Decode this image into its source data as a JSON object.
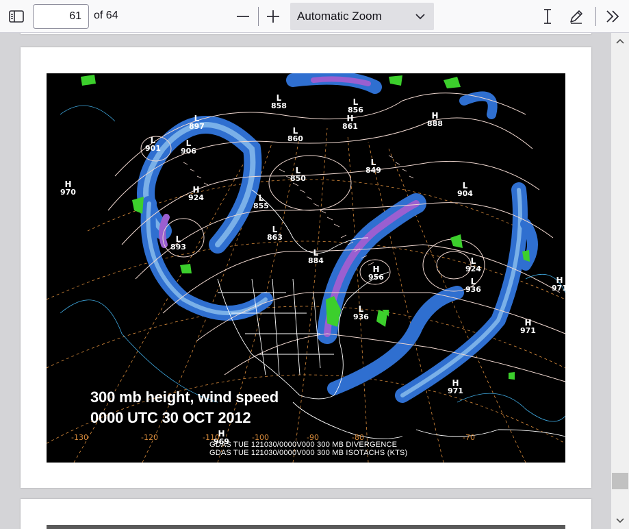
{
  "toolbar": {
    "current_page": "61",
    "page_count_label": "of 64",
    "zoom_label": "Automatic Zoom",
    "icons": {
      "sidebar": "sidebar-toggle-icon",
      "zoom_out": "minus-icon",
      "zoom_in": "plus-icon",
      "chevron": "chevron-down-icon",
      "text_select": "text-cursor-icon",
      "draw": "pen-icon",
      "more": "double-chevron-right-icon"
    }
  },
  "figure": {
    "caption_line1": "300 mb height, wind speed",
    "caption_line2": "0000 UTC 30 OCT 2012",
    "footer_line1": "GDAS TUE 121030/0000V000 300 MB DIVERGENCE",
    "footer_line2": "GDAS TUE 121030/0000V000 300 MB ISOTACHS (KTS)",
    "longitude_labels": [
      "-130",
      "-120",
      "-110",
      "-100",
      "-90",
      "-80",
      "-70"
    ],
    "pressure_centers": [
      {
        "type": "H",
        "value": "970"
      },
      {
        "type": "L",
        "value": "901"
      },
      {
        "type": "L",
        "value": "906"
      },
      {
        "type": "L",
        "value": "897"
      },
      {
        "type": "H",
        "value": "924"
      },
      {
        "type": "L",
        "value": "893"
      },
      {
        "type": "L",
        "value": "858"
      },
      {
        "type": "L",
        "value": "856"
      },
      {
        "type": "H",
        "value": "861"
      },
      {
        "type": "L",
        "value": "860"
      },
      {
        "type": "L",
        "value": "850"
      },
      {
        "type": "L",
        "value": "855"
      },
      {
        "type": "L",
        "value": "863"
      },
      {
        "type": "L",
        "value": "884"
      },
      {
        "type": "L",
        "value": "849"
      },
      {
        "type": "H",
        "value": "888"
      },
      {
        "type": "L",
        "value": "904"
      },
      {
        "type": "H",
        "value": "971"
      },
      {
        "type": "H",
        "value": "971"
      },
      {
        "type": "H",
        "value": "971"
      },
      {
        "type": "H",
        "value": "969"
      },
      {
        "type": "L",
        "value": "924"
      },
      {
        "type": "L",
        "value": "936"
      },
      {
        "type": "L",
        "value": "936"
      },
      {
        "type": "H",
        "value": "956"
      }
    ],
    "colors": {
      "isotach_blue": "#2f6fd0",
      "isotach_light": "#7ab0e8",
      "isotach_purple": "#9a5fd0",
      "divergence_green": "#3ccf2c",
      "contour": "#f0d8d0",
      "longitude": "#d98c3c"
    }
  },
  "scrollbar": {
    "up_icon": "arrow-up-icon",
    "down_icon": "arrow-down-icon"
  }
}
